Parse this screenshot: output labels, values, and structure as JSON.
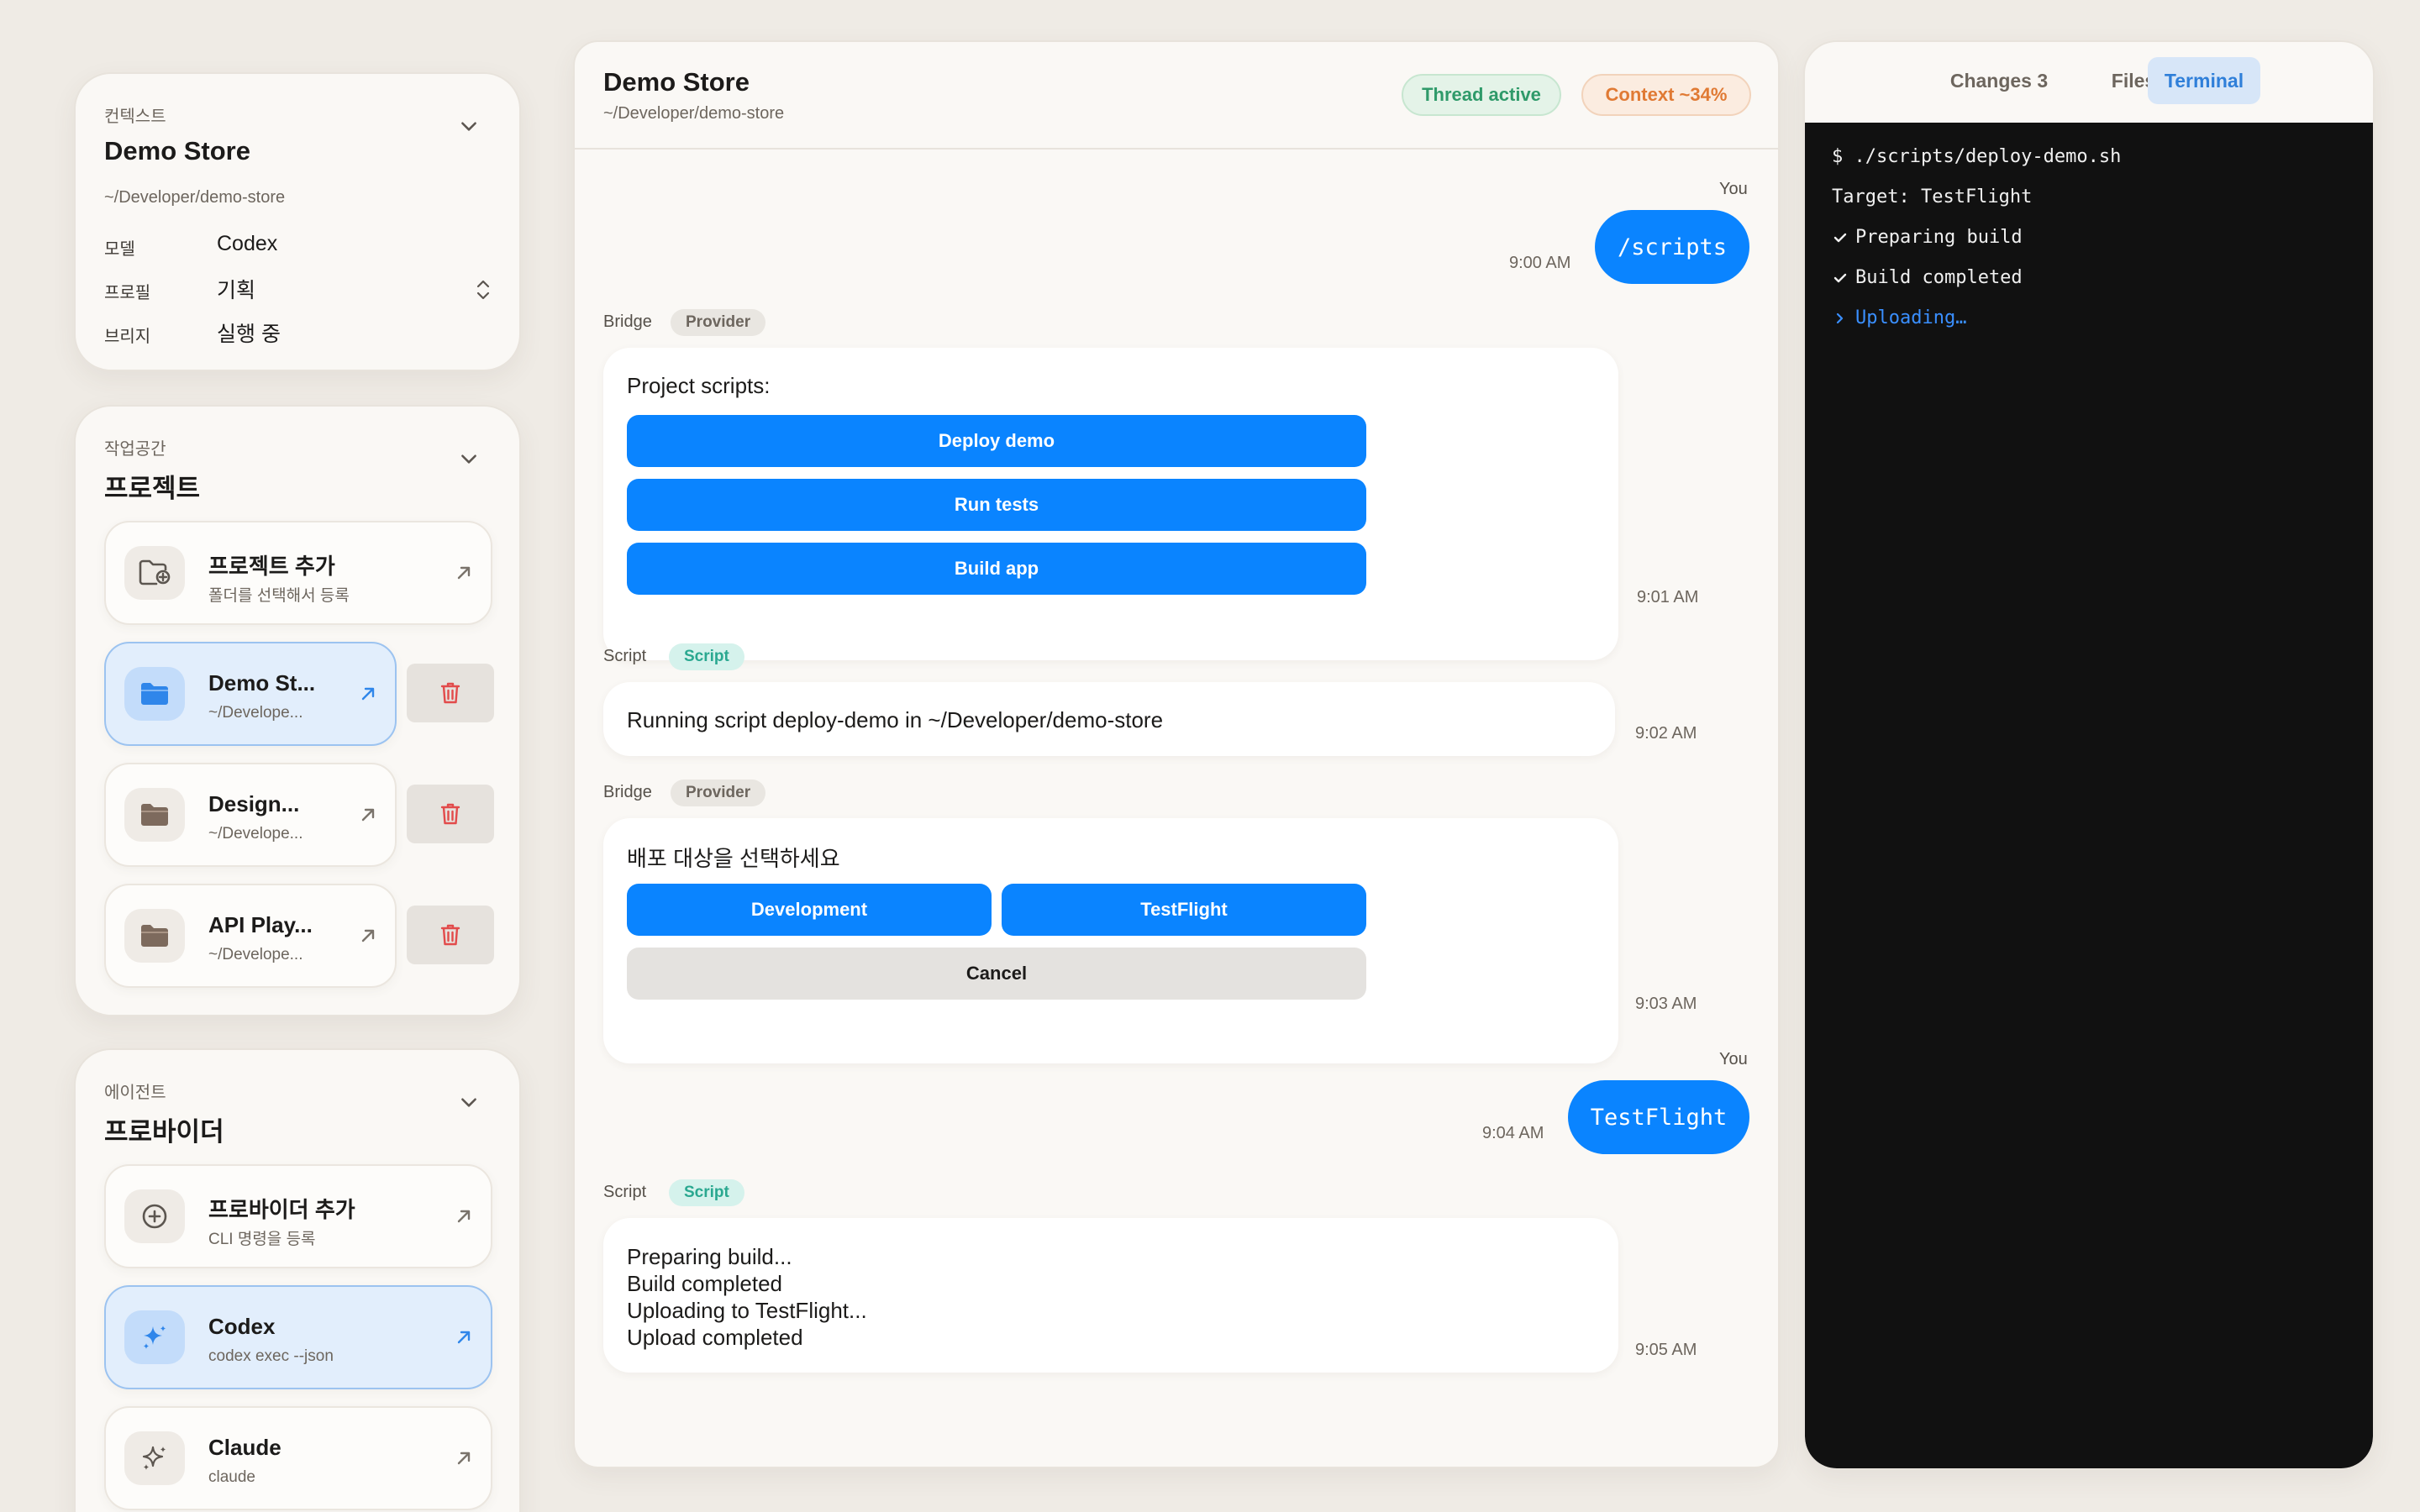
{
  "context": {
    "sub": "컨텍스트",
    "title": "Demo Store",
    "path": "~/Developer/demo-store",
    "rows": [
      {
        "key": "모델",
        "value": "Codex"
      },
      {
        "key": "프로필",
        "value": "기획"
      },
      {
        "key": "브리지",
        "value": "실행 중"
      }
    ]
  },
  "workspace": {
    "sub": "작업공간",
    "title": "프로젝트",
    "add": {
      "name": "프로젝트 추가",
      "sub": "폴더를 선택해서 등록"
    },
    "projects": [
      {
        "name": "Demo St...",
        "sub": "~/Develope..."
      },
      {
        "name": "Design...",
        "sub": "~/Develope..."
      },
      {
        "name": "API Play...",
        "sub": "~/Develope..."
      }
    ]
  },
  "agents": {
    "sub": "에이전트",
    "title": "프로바이더",
    "add": {
      "name": "프로바이더 추가",
      "sub": "CLI 명령을 등록"
    },
    "providers": [
      {
        "name": "Codex",
        "sub": "codex exec --json"
      },
      {
        "name": "Claude",
        "sub": "claude"
      }
    ]
  },
  "chat": {
    "title": "Demo Store",
    "path": "~/Developer/demo-store",
    "badge_thread": "Thread active",
    "badge_context": "Context ~34%",
    "messages": [
      {
        "who": "You",
        "text": "/scripts",
        "time": "9:00 AM"
      },
      {
        "who": "Bridge",
        "tag": "Provider",
        "text": "Project scripts:",
        "buttons": [
          "Deploy demo",
          "Run tests",
          "Build app"
        ],
        "time": "9:01 AM"
      },
      {
        "who": "Script",
        "tag": "Script",
        "text": "Running script deploy-demo in ~/Developer/demo-store",
        "time": "9:02 AM"
      },
      {
        "who": "Bridge",
        "tag": "Provider",
        "text": "배포 대상을 선택하세요",
        "buttons": [
          "Development",
          "TestFlight",
          "Cancel"
        ],
        "time": "9:03 AM"
      },
      {
        "who": "You",
        "text": "TestFlight",
        "time": "9:04 AM"
      },
      {
        "who": "Script",
        "tag": "Script",
        "lines": [
          "Preparing build...",
          "Build completed",
          "Uploading to TestFlight...",
          "Upload completed"
        ],
        "time": "9:05 AM"
      }
    ]
  },
  "panel": {
    "tabs": [
      "Changes 3",
      "Files",
      "Terminal"
    ],
    "active_tab": "Terminal",
    "terminal": [
      {
        "text": "$ ./scripts/deploy-demo.sh"
      },
      {
        "text": "Target: TestFlight"
      },
      {
        "text": "Preparing build"
      },
      {
        "text": "Build completed"
      },
      {
        "text": "Uploading…"
      }
    ]
  },
  "colors": {
    "accent": "#0a84ff",
    "background": "#efebe5",
    "card": "#faf8f5",
    "terminal_bg": "#111111",
    "thread_badge": "#2f9a6a",
    "context_badge": "#e07a34",
    "script_tag": "#2aa890",
    "delete_icon": "#e24b4b"
  }
}
